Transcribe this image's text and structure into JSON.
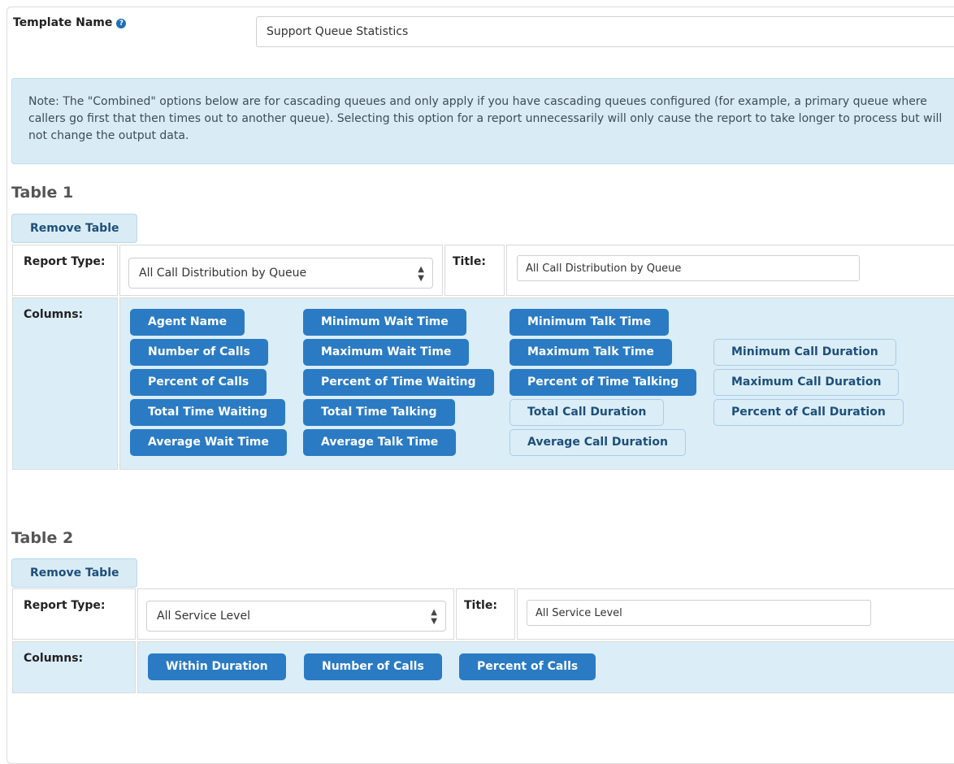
{
  "template": {
    "label": "Template Name",
    "help_icon": "question-circle-icon",
    "value": "Support Queue Statistics"
  },
  "note": {
    "text": "Note: The \"Combined\" options below are for cascading queues and only apply if you have cascading queues configured (for example, a primary queue where callers go first that then times out to another queue). Selecting this option for a report unnecessarily will only cause the report to take longer to process but will not change the output data."
  },
  "colors": {
    "selected_chip": "#2a7bc4",
    "unselected_chip": "#dbedf7",
    "note_bg": "#d9ecf6"
  },
  "table1": {
    "heading": "Table 1",
    "remove_label": "Remove Table",
    "report_type_label": "Report Type:",
    "report_type_value": "All Call Distribution by Queue",
    "title_label": "Title:",
    "title_value": "All Call Distribution by Queue",
    "columns_label": "Columns:",
    "columns": [
      {
        "label": "Agent Name",
        "selected": true
      },
      {
        "label": "Number of Calls",
        "selected": true
      },
      {
        "label": "Percent of Calls",
        "selected": true
      },
      {
        "label": "Total Time Waiting",
        "selected": true
      },
      {
        "label": "Average Wait Time",
        "selected": true
      },
      {
        "label": "Minimum Wait Time",
        "selected": true
      },
      {
        "label": "Maximum Wait Time",
        "selected": true
      },
      {
        "label": "Percent of Time Waiting",
        "selected": true
      },
      {
        "label": "Total Time Talking",
        "selected": true
      },
      {
        "label": "Average Talk Time",
        "selected": true
      },
      {
        "label": "Minimum Talk Time",
        "selected": true
      },
      {
        "label": "Maximum Talk Time",
        "selected": true
      },
      {
        "label": "Percent of Time Talking",
        "selected": true
      },
      {
        "label": "Total Call Duration",
        "selected": false
      },
      {
        "label": "Average Call Duration",
        "selected": false
      },
      {
        "label": "Minimum Call Duration",
        "selected": false
      },
      {
        "label": "Maximum Call Duration",
        "selected": false
      },
      {
        "label": "Percent of Call Duration",
        "selected": false
      }
    ]
  },
  "table2": {
    "heading": "Table 2",
    "remove_label": "Remove Table",
    "report_type_label": "Report Type:",
    "report_type_value": "All Service Level",
    "title_label": "Title:",
    "title_value": "All Service Level",
    "columns_label": "Columns:",
    "columns": [
      {
        "label": "Within Duration",
        "selected": true
      },
      {
        "label": "Number of Calls",
        "selected": true
      },
      {
        "label": "Percent of Calls",
        "selected": true
      }
    ]
  }
}
